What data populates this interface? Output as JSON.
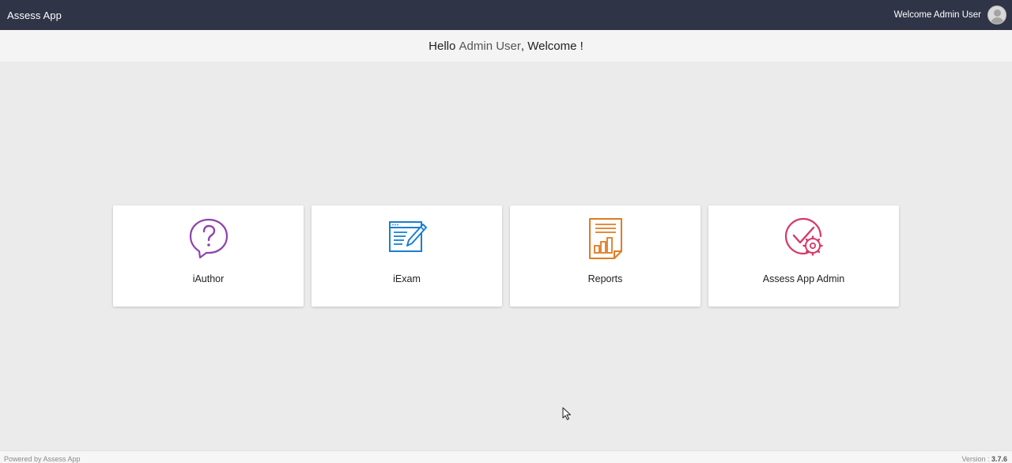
{
  "header": {
    "app_title": "Assess App",
    "welcome_text": "Welcome Admin User"
  },
  "greeting": {
    "prefix": "Hello ",
    "name": "Admin User",
    "suffix": ", Welcome !"
  },
  "tiles": [
    {
      "label": "iAuthor",
      "icon": "question-bubble-icon",
      "color": "#8e44ad"
    },
    {
      "label": "iExam",
      "icon": "exam-edit-icon",
      "color": "#1a7fd1"
    },
    {
      "label": "Reports",
      "icon": "report-document-icon",
      "color": "#e07b22"
    },
    {
      "label": "Assess App Admin",
      "icon": "admin-settings-icon",
      "color": "#d63a6a"
    }
  ],
  "footer": {
    "powered_by": "Powered by Assess App",
    "version_label": "Version : ",
    "version_number": "3.7.6"
  }
}
